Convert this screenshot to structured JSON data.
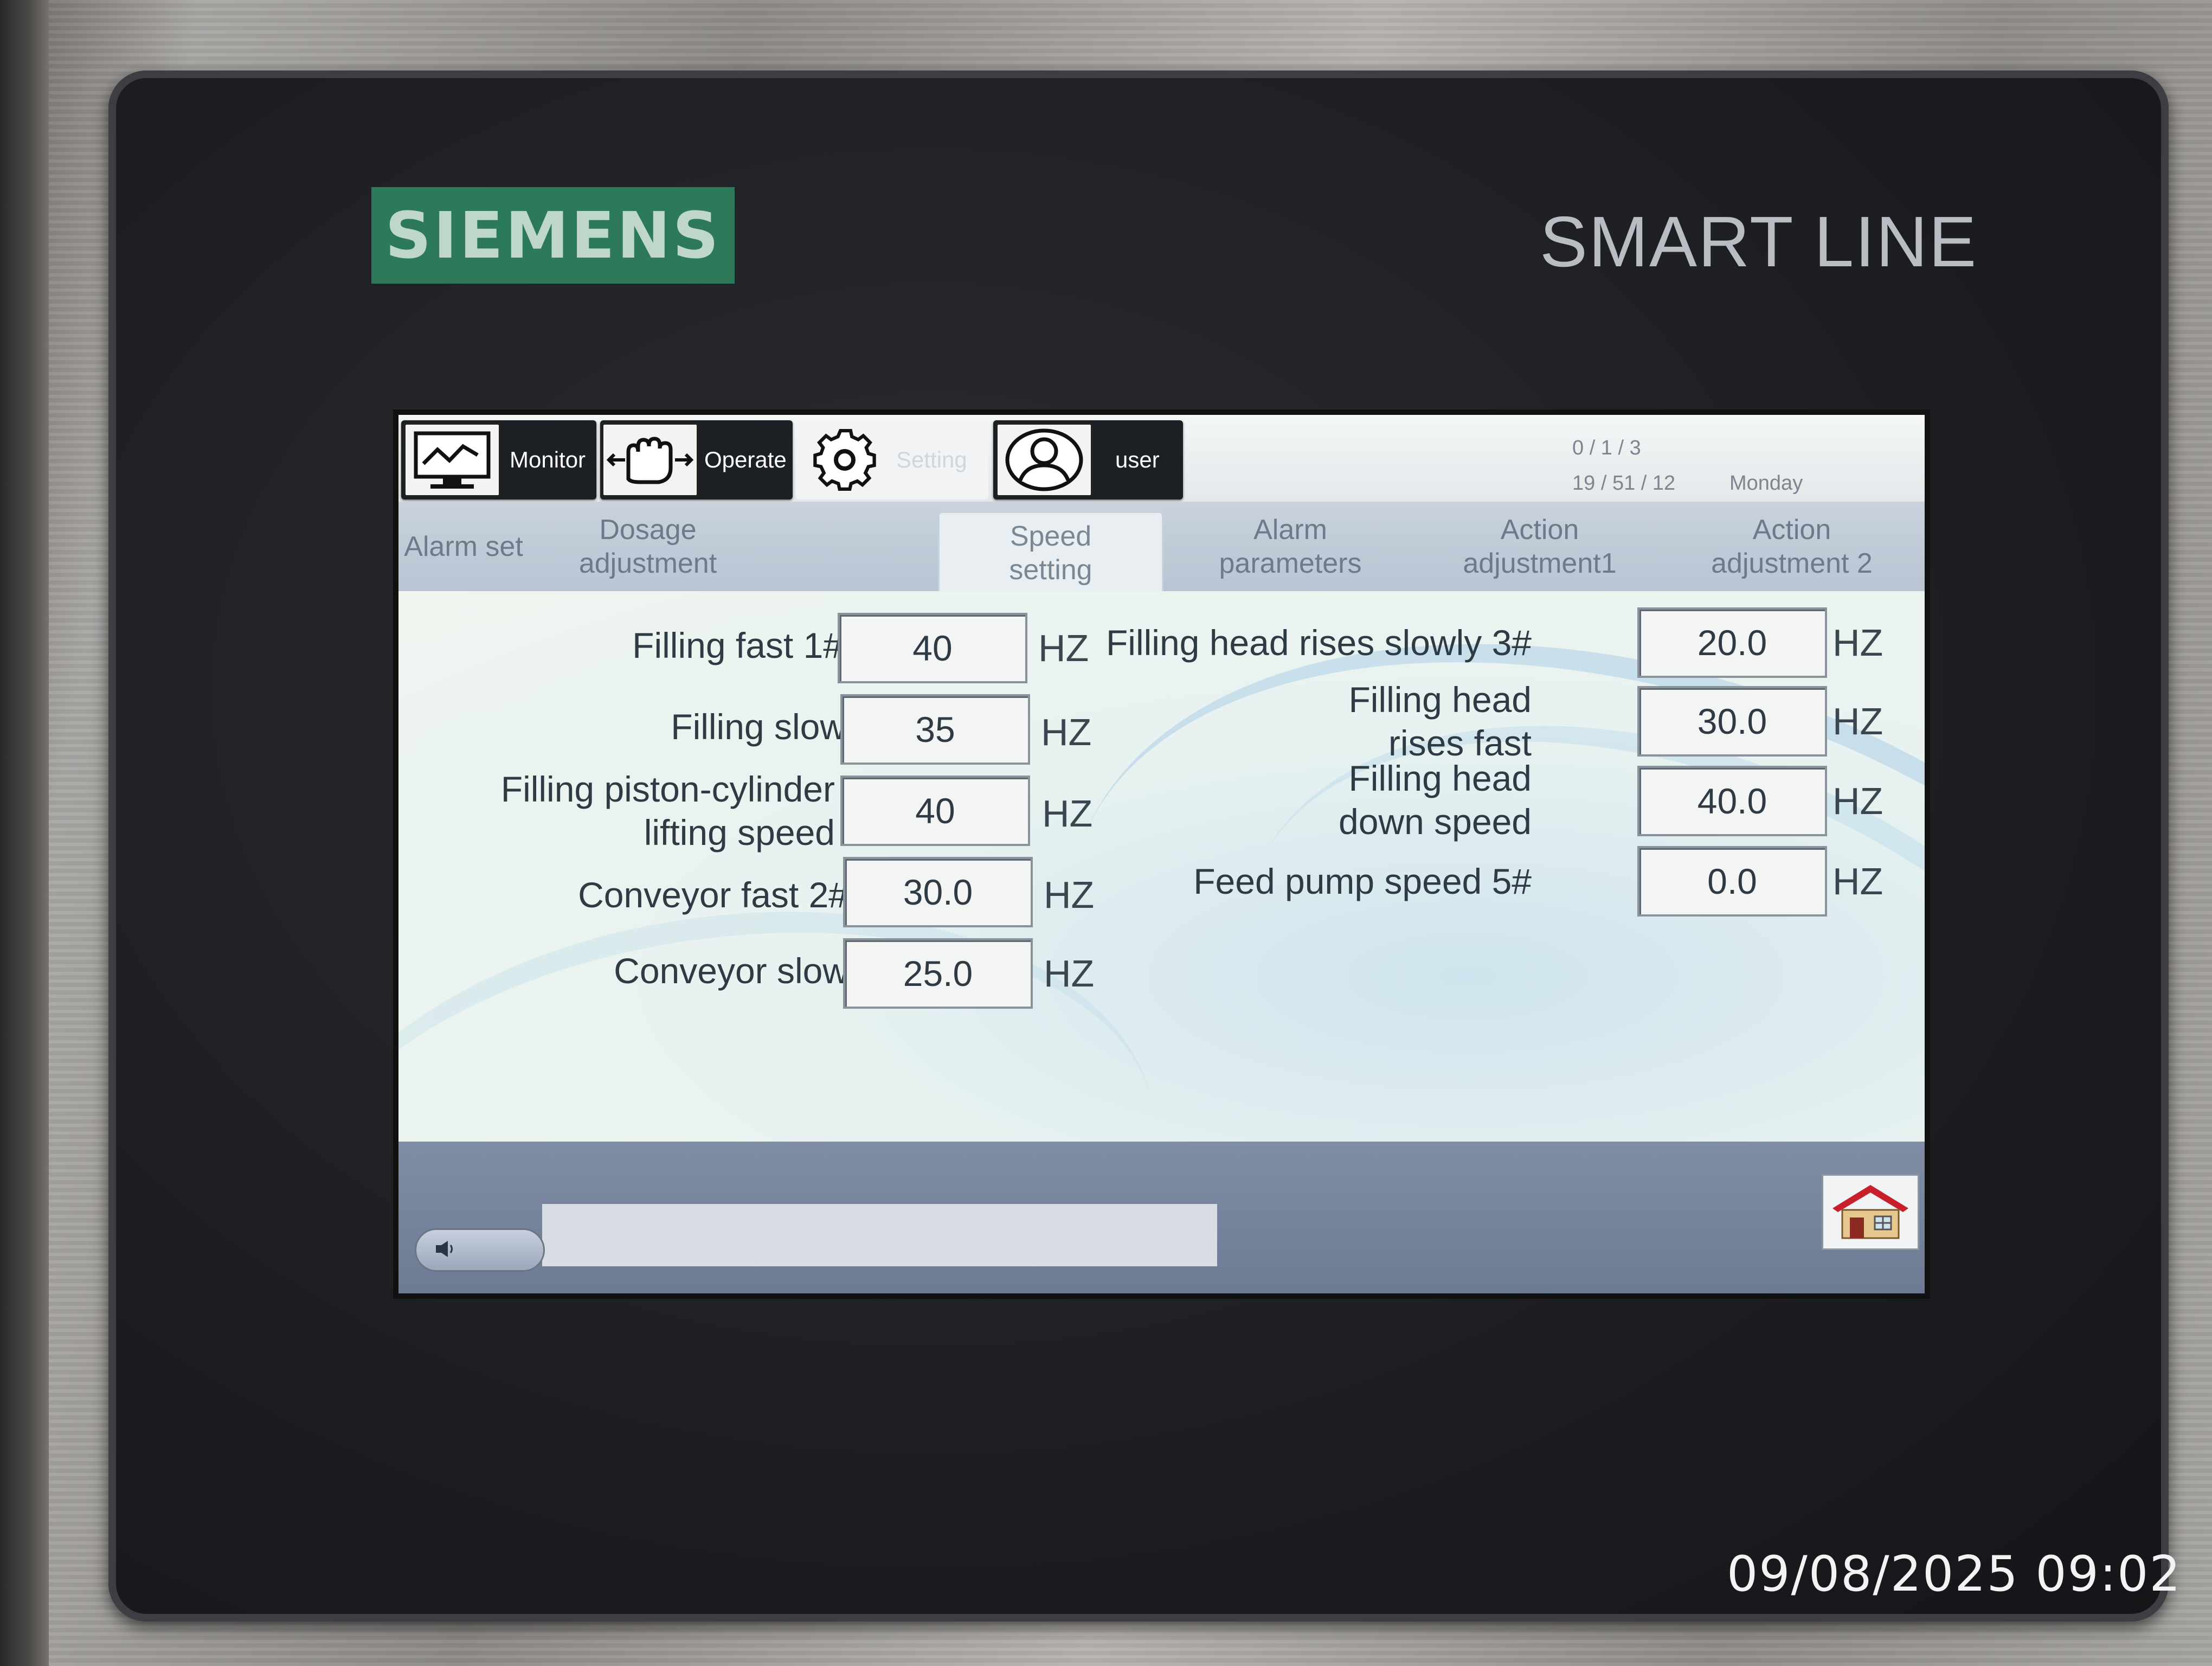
{
  "device": {
    "brand": "SIEMENS",
    "model_line": "SMART LINE"
  },
  "nav": [
    {
      "label": "Monitor",
      "icon": "monitor-trend-icon"
    },
    {
      "label": "Operate",
      "icon": "hand-icon"
    },
    {
      "label": "Setting",
      "icon": "gear-icon"
    },
    {
      "label": "user",
      "icon": "user-icon"
    }
  ],
  "datetime": {
    "date": "0  / 1  / 3",
    "time": "19 / 51 / 12",
    "weekday": "Monday"
  },
  "tabs": [
    {
      "label": "Alarm set",
      "active": false
    },
    {
      "label": "Dosage\nadjustment",
      "active": false
    },
    {
      "label": "Speed\nsetting",
      "active": true
    },
    {
      "label": "Alarm\nparameters",
      "active": false
    },
    {
      "label": "Action\nadjustment1",
      "active": false
    },
    {
      "label": "Action\nadjustment 2",
      "active": false
    }
  ],
  "left_params": [
    {
      "label": "Filling fast 1#",
      "value": "40",
      "unit": "HZ"
    },
    {
      "label": "Filling slow",
      "value": "35",
      "unit": "HZ"
    },
    {
      "label": "Filling piston-cylinder\nlifting speed",
      "value": "40",
      "unit": "HZ"
    },
    {
      "label": "Conveyor fast 2#",
      "value": "30.0",
      "unit": "HZ"
    },
    {
      "label": "Conveyor slow",
      "value": "25.0",
      "unit": "HZ"
    }
  ],
  "right_params": [
    {
      "label": "Filling head rises slowly 3#",
      "value": "20.0",
      "unit": "HZ"
    },
    {
      "label": "Filling head\nrises fast",
      "value": "30.0",
      "unit": "HZ"
    },
    {
      "label": "Filling head\ndown speed",
      "value": "40.0",
      "unit": "HZ"
    },
    {
      "label": "Feed pump speed 5#",
      "value": "0.0",
      "unit": "HZ"
    }
  ],
  "bottom": {
    "speaker_icon": "speaker-icon",
    "home_icon": "home-icon"
  },
  "photo_timestamp": "09/08/2025 09:02"
}
